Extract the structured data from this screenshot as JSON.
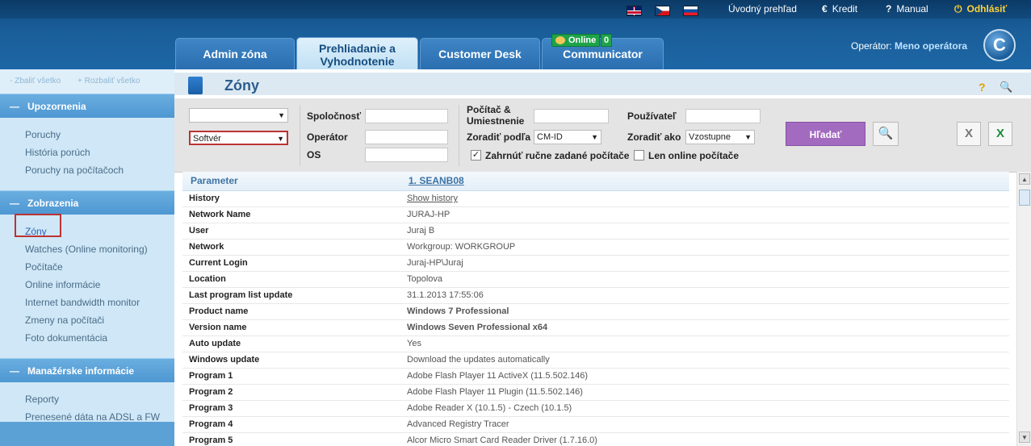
{
  "top_links": {
    "overview": "Úvodný prehľad",
    "credit": "Kredit",
    "manual": "Manual",
    "logout": "Odhlásiť"
  },
  "icons": {
    "credit": "€",
    "manual": "?",
    "logout": "⏻"
  },
  "operator": {
    "label": "Operátor:",
    "name": "Meno operátora"
  },
  "logo_letter": "C",
  "tabs": {
    "admin": "Admin zóna",
    "prehl_line1": "Prehliadanie a",
    "prehl_line2": "Vyhodnotenie",
    "customer": "Customer Desk",
    "communicator": "Communicator"
  },
  "online_badge": {
    "label": "Online",
    "count": "0"
  },
  "sidebar": {
    "collapse_all": "- Zbaliť všetko",
    "expand_all": "+ Rozbaliť všetko",
    "sections": [
      {
        "title": "Upozornenia",
        "items": [
          "Poruchy",
          "História porúch",
          "Poruchy na počítačoch"
        ]
      },
      {
        "title": "Zobrazenia",
        "items": [
          "Zóny",
          "Watches (Online monitoring)",
          "Počítače",
          "Online informácie",
          "Internet bandwidth monitor",
          "Zmeny na počítači",
          "Foto dokumentácia"
        ]
      },
      {
        "title": "Manažérske informácie",
        "items": [
          "Reporty",
          "Prenesené dáta na ADSL a FW"
        ]
      }
    ]
  },
  "page_title": "Zóny",
  "filters": {
    "category_select": "Softvér",
    "spolocnost": "Spoločnosť",
    "operator": "Operátor",
    "os": "OS",
    "pocitac_line1": "Počítač &",
    "pocitac_line2": "Umiestnenie",
    "zoradit_podla": "Zoradiť podľa",
    "zoradit_podla_value": "CM-ID",
    "pouzivatel": "Používateľ",
    "zoradit_ako": "Zoradiť ako",
    "zoradit_ako_value": "Vzostupne",
    "include_manual": "Zahrnúť ručne zadané počítače",
    "include_manual_checked": true,
    "only_online": "Len online počítače",
    "only_online_checked": false,
    "search_button": "Hľadať"
  },
  "table": {
    "header_param": "Parameter",
    "header_computer": "1. SEANB08",
    "rows": [
      {
        "p": "History",
        "v": "Show history"
      },
      {
        "p": "Network Name",
        "v": "JURAJ-HP"
      },
      {
        "p": "User",
        "v": "Juraj B"
      },
      {
        "p": "Network",
        "v": "Workgroup: WORKGROUP"
      },
      {
        "p": "Current Login",
        "v": "Juraj-HP\\Juraj"
      },
      {
        "p": "Location",
        "v": "Topolova"
      },
      {
        "p": "Last program list update",
        "v": "31.1.2013 17:55:06"
      },
      {
        "p": "Product name",
        "v": "Windows 7 Professional"
      },
      {
        "p": "Version name",
        "v": "Windows Seven Professional x64"
      },
      {
        "p": "Auto update",
        "v": "Yes"
      },
      {
        "p": "Windows update",
        "v": "Download the updates automatically"
      },
      {
        "p": "Program 1",
        "v": "Adobe Flash Player 11 ActiveX (11.5.502.146)"
      },
      {
        "p": "Program 2",
        "v": "Adobe Flash Player 11 Plugin (11.5.502.146)"
      },
      {
        "p": "Program 3",
        "v": "Adobe Reader X (10.1.5) - Czech (10.1.5)"
      },
      {
        "p": "Program 4",
        "v": "Advanced Registry Tracer"
      },
      {
        "p": "Program 5",
        "v": "Alcor Micro Smart Card Reader Driver (1.7.16.0)"
      }
    ]
  }
}
